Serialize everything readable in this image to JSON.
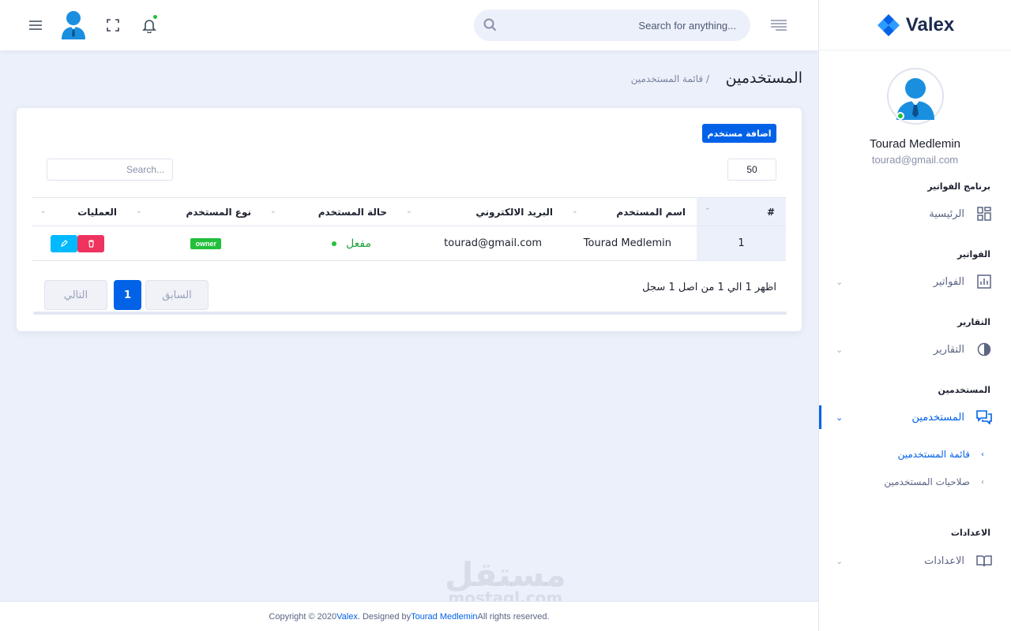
{
  "brand": {
    "name": "Valex"
  },
  "header": {
    "search_placeholder": "Search for anything...",
    "icons": [
      "menu-icon",
      "user-avatar",
      "fullscreen-icon",
      "bell-icon",
      "search-icon",
      "text-lines-icon"
    ]
  },
  "profile": {
    "name": "Tourad Medlemin",
    "email": "tourad@gmail.com"
  },
  "sidebar": {
    "categories": [
      "برنامج الفواتير",
      "الفواتير",
      "التقارير",
      "المستخدمين",
      "الاعدادات"
    ],
    "items": [
      {
        "label": "الرئيسية",
        "icon": "dashboard-icon"
      },
      {
        "label": "الفواتير",
        "icon": "bar-chart-icon"
      },
      {
        "label": "التقارير",
        "icon": "pie-chart-icon"
      },
      {
        "label": "المستخدمين",
        "icon": "chat-icon"
      },
      {
        "label": "الاعدادات",
        "icon": "book-icon"
      }
    ],
    "sub_items": [
      "قائمة المستخدمين",
      "صلاحيات المستخدمين"
    ]
  },
  "page": {
    "title": "المستخدمين",
    "breadcrumb": "/ قائمة المستخدمين"
  },
  "card": {
    "add_button": "اضافة مستخدم",
    "page_length": "50",
    "search_placeholder": "Search...",
    "columns": [
      "#",
      "اسم المستخدم",
      "البريد الالكتروني",
      "حالة المستخدم",
      "نوع المستخدم",
      "العمليات"
    ],
    "rows": [
      {
        "num": "1",
        "name": "Tourad Medlemin",
        "email": "tourad@gmail.com",
        "status": "مفعل",
        "type": "owner"
      }
    ],
    "info": "اظهر 1 الي 1 من اصل 1 سجل",
    "pagination": {
      "prev": "السابق",
      "current": "1",
      "next": "التالي"
    }
  },
  "footer": {
    "prefix": "Copyright © 2020 ",
    "brand": "Valex",
    "mid": ". Designed by ",
    "author": "Tourad Medlemin",
    "suffix": " All rights reserved."
  },
  "watermark": {
    "arabic": "مستقل",
    "latin": "mostaql.com"
  },
  "colors": {
    "primary": "#0162e8",
    "success": "#22c03c",
    "danger": "#ee335e",
    "info": "#00b9ff",
    "body_bg": "#ecf0fa"
  }
}
